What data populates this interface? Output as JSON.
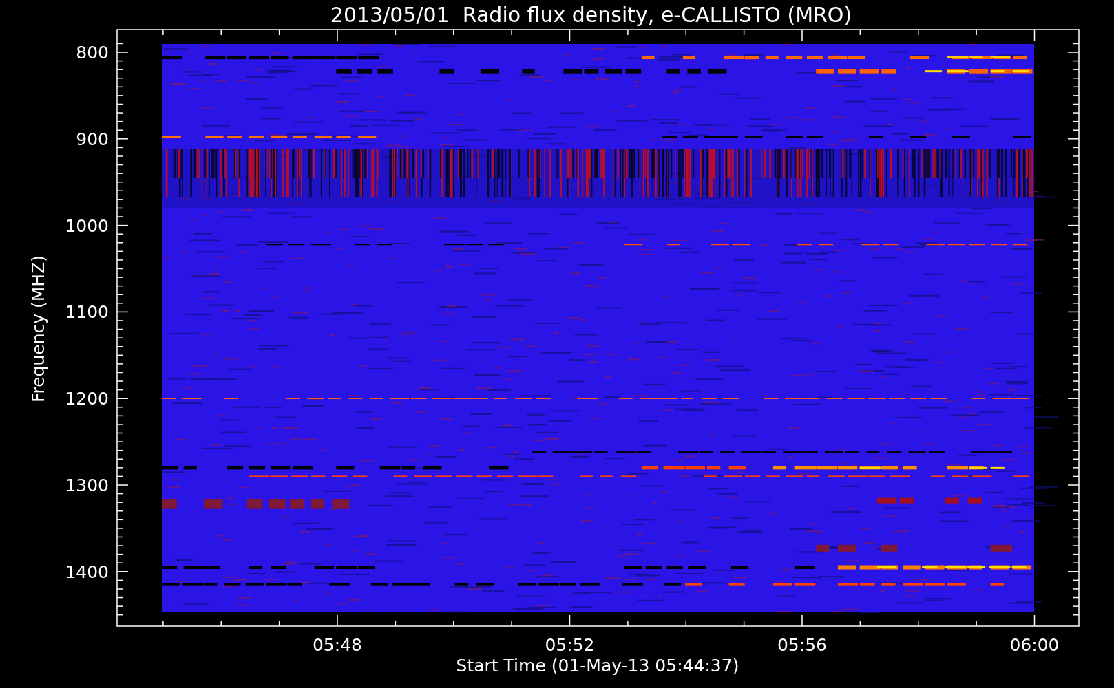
{
  "title": "2013/05/01  Radio flux density, e-CALLISTO (MRO)",
  "ylabel": "Frequency (MHZ)",
  "xlabel": "Start Time (01-May-13 05:44:37)",
  "yticks": [
    "800",
    "900",
    "1000",
    "1100",
    "1200",
    "1300",
    "1400"
  ],
  "xticks": [
    "05:48",
    "05:52",
    "05:56",
    "06:00"
  ]
}
